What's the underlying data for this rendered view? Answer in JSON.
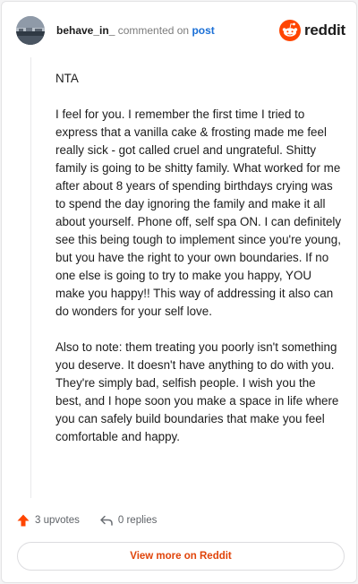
{
  "comment": {
    "author": "behave_in_",
    "action": "commented on",
    "post_link": "post",
    "paragraphs": [
      "NTA",
      "I feel for you. I remember the first time I tried to express that a vanilla cake & frosting made me feel really sick - got called cruel and ungrateful. Shitty family is going to be shitty family. What worked for me after about 8 years of spending birthdays crying was to spend the day ignoring the family and make it all about yourself. Phone off, self spa ON. I can definitely see this being tough to implement since you're young, but you have the right to your own boundaries. If no one else is going to try to make you happy, YOU make you happy!! This way of addressing it also can do wonders for your self love.",
      "Also to note: them treating you poorly isn't something you deserve. It doesn't have anything to do with you. They're simply bad, selfish people. I wish you the best, and I hope soon you make a space in life where you can safely build boundaries that make you feel comfortable and happy."
    ]
  },
  "brand": {
    "name": "reddit",
    "color": "#ff4500"
  },
  "stats": {
    "upvotes": "3 upvotes",
    "replies": "0 replies"
  },
  "cta": {
    "label": "View more on Reddit"
  },
  "icons": {
    "upvote": "upvote-arrow-icon",
    "reply": "reply-arrow-icon",
    "logo": "reddit-snoo-icon"
  }
}
